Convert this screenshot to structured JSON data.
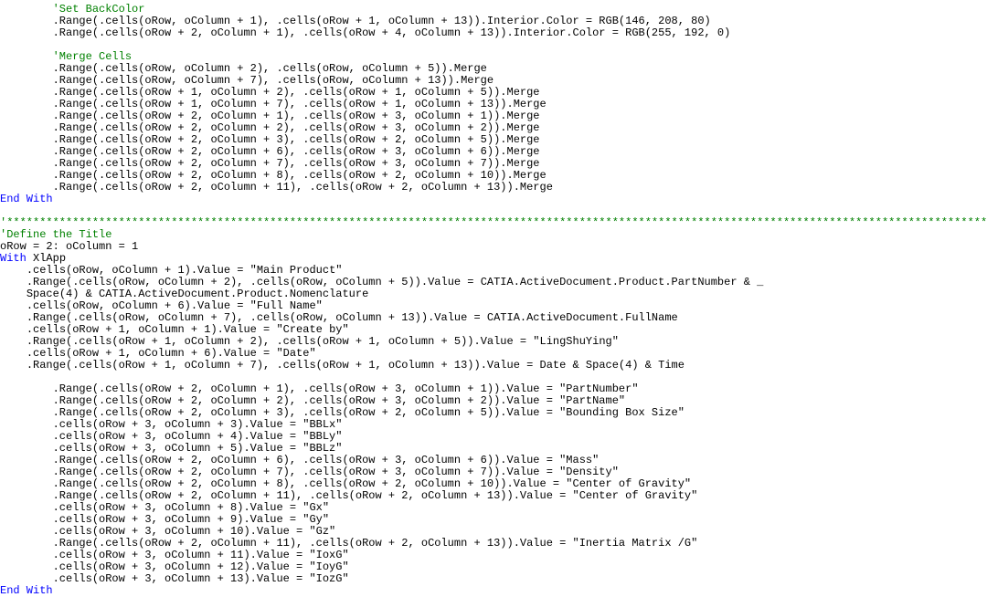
{
  "code_lines": [
    {
      "indent": 8,
      "spans": [
        {
          "cls": "c-comment",
          "text": "'Set BackColor"
        }
      ]
    },
    {
      "indent": 8,
      "spans": [
        {
          "cls": "",
          "text": ".Range(.cells(oRow, oColumn + 1), .cells(oRow + 1, oColumn + 13)).Interior.Color = RGB(146, 208, 80)"
        }
      ]
    },
    {
      "indent": 8,
      "spans": [
        {
          "cls": "",
          "text": ".Range(.cells(oRow + 2, oColumn + 1), .cells(oRow + 4, oColumn + 13)).Interior.Color = RGB(255, 192, 0)"
        }
      ]
    },
    {
      "indent": 0,
      "spans": [
        {
          "cls": "",
          "text": ""
        }
      ]
    },
    {
      "indent": 8,
      "spans": [
        {
          "cls": "c-comment",
          "text": "'Merge Cells"
        }
      ]
    },
    {
      "indent": 8,
      "spans": [
        {
          "cls": "",
          "text": ".Range(.cells(oRow, oColumn + 2), .cells(oRow, oColumn + 5)).Merge"
        }
      ]
    },
    {
      "indent": 8,
      "spans": [
        {
          "cls": "",
          "text": ".Range(.cells(oRow, oColumn + 7), .cells(oRow, oColumn + 13)).Merge"
        }
      ]
    },
    {
      "indent": 8,
      "spans": [
        {
          "cls": "",
          "text": ".Range(.cells(oRow + 1, oColumn + 2), .cells(oRow + 1, oColumn + 5)).Merge"
        }
      ]
    },
    {
      "indent": 8,
      "spans": [
        {
          "cls": "",
          "text": ".Range(.cells(oRow + 1, oColumn + 7), .cells(oRow + 1, oColumn + 13)).Merge"
        }
      ]
    },
    {
      "indent": 8,
      "spans": [
        {
          "cls": "",
          "text": ".Range(.cells(oRow + 2, oColumn + 1), .cells(oRow + 3, oColumn + 1)).Merge"
        }
      ]
    },
    {
      "indent": 8,
      "spans": [
        {
          "cls": "",
          "text": ".Range(.cells(oRow + 2, oColumn + 2), .cells(oRow + 3, oColumn + 2)).Merge"
        }
      ]
    },
    {
      "indent": 8,
      "spans": [
        {
          "cls": "",
          "text": ".Range(.cells(oRow + 2, oColumn + 3), .cells(oRow + 2, oColumn + 5)).Merge"
        }
      ]
    },
    {
      "indent": 8,
      "spans": [
        {
          "cls": "",
          "text": ".Range(.cells(oRow + 2, oColumn + 6), .cells(oRow + 3, oColumn + 6)).Merge"
        }
      ]
    },
    {
      "indent": 8,
      "spans": [
        {
          "cls": "",
          "text": ".Range(.cells(oRow + 2, oColumn + 7), .cells(oRow + 3, oColumn + 7)).Merge"
        }
      ]
    },
    {
      "indent": 8,
      "spans": [
        {
          "cls": "",
          "text": ".Range(.cells(oRow + 2, oColumn + 8), .cells(oRow + 2, oColumn + 10)).Merge"
        }
      ]
    },
    {
      "indent": 8,
      "spans": [
        {
          "cls": "",
          "text": ".Range(.cells(oRow + 2, oColumn + 11), .cells(oRow + 2, oColumn + 13)).Merge"
        }
      ]
    },
    {
      "indent": 0,
      "spans": [
        {
          "cls": "c-keyword",
          "text": "End With"
        }
      ]
    },
    {
      "indent": 0,
      "spans": [
        {
          "cls": "",
          "text": ""
        }
      ]
    },
    {
      "indent": 0,
      "spans": [
        {
          "cls": "c-comment",
          "text": "'*******************************************************************************************************************************************************************************"
        }
      ]
    },
    {
      "indent": 0,
      "spans": [
        {
          "cls": "c-comment",
          "text": "'Define the Title"
        }
      ]
    },
    {
      "indent": 0,
      "spans": [
        {
          "cls": "",
          "text": "oRow = 2: oColumn = 1"
        }
      ]
    },
    {
      "indent": 0,
      "spans": [
        {
          "cls": "c-keyword",
          "text": "With"
        },
        {
          "cls": "",
          "text": " XlApp"
        }
      ]
    },
    {
      "indent": 4,
      "spans": [
        {
          "cls": "",
          "text": ".cells(oRow, oColumn + 1).Value = \"Main Product\""
        }
      ]
    },
    {
      "indent": 4,
      "spans": [
        {
          "cls": "",
          "text": ".Range(.cells(oRow, oColumn + 2), .cells(oRow, oColumn + 5)).Value = CATIA.ActiveDocument.Product.PartNumber & _"
        }
      ]
    },
    {
      "indent": 4,
      "spans": [
        {
          "cls": "",
          "text": "Space(4) & CATIA.ActiveDocument.Product.Nomenclature"
        }
      ]
    },
    {
      "indent": 4,
      "spans": [
        {
          "cls": "",
          "text": ".cells(oRow, oColumn + 6).Value = \"Full Name\""
        }
      ]
    },
    {
      "indent": 4,
      "spans": [
        {
          "cls": "",
          "text": ".Range(.cells(oRow, oColumn + 7), .cells(oRow, oColumn + 13)).Value = CATIA.ActiveDocument.FullName"
        }
      ]
    },
    {
      "indent": 4,
      "spans": [
        {
          "cls": "",
          "text": ".cells(oRow + 1, oColumn + 1).Value = \"Create by\""
        }
      ]
    },
    {
      "indent": 4,
      "spans": [
        {
          "cls": "",
          "text": ".Range(.cells(oRow + 1, oColumn + 2), .cells(oRow + 1, oColumn + 5)).Value = \"LingShuYing\""
        }
      ]
    },
    {
      "indent": 4,
      "spans": [
        {
          "cls": "",
          "text": ".cells(oRow + 1, oColumn + 6).Value = \"Date\""
        }
      ]
    },
    {
      "indent": 4,
      "spans": [
        {
          "cls": "",
          "text": ".Range(.cells(oRow + 1, oColumn + 7), .cells(oRow + 1, oColumn + 13)).Value = Date & Space(4) & Time"
        }
      ]
    },
    {
      "indent": 0,
      "spans": [
        {
          "cls": "",
          "text": ""
        }
      ]
    },
    {
      "indent": 8,
      "spans": [
        {
          "cls": "",
          "text": ".Range(.cells(oRow + 2, oColumn + 1), .cells(oRow + 3, oColumn + 1)).Value = \"PartNumber\""
        }
      ]
    },
    {
      "indent": 8,
      "spans": [
        {
          "cls": "",
          "text": ".Range(.cells(oRow + 2, oColumn + 2), .cells(oRow + 3, oColumn + 2)).Value = \"PartName\""
        }
      ]
    },
    {
      "indent": 8,
      "spans": [
        {
          "cls": "",
          "text": ".Range(.cells(oRow + 2, oColumn + 3), .cells(oRow + 2, oColumn + 5)).Value = \"Bounding Box Size\""
        }
      ]
    },
    {
      "indent": 8,
      "spans": [
        {
          "cls": "",
          "text": ".cells(oRow + 3, oColumn + 3).Value = \"BBLx\""
        }
      ]
    },
    {
      "indent": 8,
      "spans": [
        {
          "cls": "",
          "text": ".cells(oRow + 3, oColumn + 4).Value = \"BBLy\""
        }
      ]
    },
    {
      "indent": 8,
      "spans": [
        {
          "cls": "",
          "text": ".cells(oRow + 3, oColumn + 5).Value = \"BBLz\""
        }
      ]
    },
    {
      "indent": 8,
      "spans": [
        {
          "cls": "",
          "text": ".Range(.cells(oRow + 2, oColumn + 6), .cells(oRow + 3, oColumn + 6)).Value = \"Mass\""
        }
      ]
    },
    {
      "indent": 8,
      "spans": [
        {
          "cls": "",
          "text": ".Range(.cells(oRow + 2, oColumn + 7), .cells(oRow + 3, oColumn + 7)).Value = \"Density\""
        }
      ]
    },
    {
      "indent": 8,
      "spans": [
        {
          "cls": "",
          "text": ".Range(.cells(oRow + 2, oColumn + 8), .cells(oRow + 2, oColumn + 10)).Value = \"Center of Gravity\""
        }
      ]
    },
    {
      "indent": 8,
      "spans": [
        {
          "cls": "",
          "text": ".Range(.cells(oRow + 2, oColumn + 11), .cells(oRow + 2, oColumn + 13)).Value = \"Center of Gravity\""
        }
      ]
    },
    {
      "indent": 8,
      "spans": [
        {
          "cls": "",
          "text": ".cells(oRow + 3, oColumn + 8).Value = \"Gx\""
        }
      ]
    },
    {
      "indent": 8,
      "spans": [
        {
          "cls": "",
          "text": ".cells(oRow + 3, oColumn + 9).Value = \"Gy\""
        }
      ]
    },
    {
      "indent": 8,
      "spans": [
        {
          "cls": "",
          "text": ".cells(oRow + 3, oColumn + 10).Value = \"Gz\""
        }
      ]
    },
    {
      "indent": 8,
      "spans": [
        {
          "cls": "",
          "text": ".Range(.cells(oRow + 2, oColumn + 11), .cells(oRow + 2, oColumn + 13)).Value = \"Inertia Matrix /G\""
        }
      ]
    },
    {
      "indent": 8,
      "spans": [
        {
          "cls": "",
          "text": ".cells(oRow + 3, oColumn + 11).Value = \"IoxG\""
        }
      ]
    },
    {
      "indent": 8,
      "spans": [
        {
          "cls": "",
          "text": ".cells(oRow + 3, oColumn + 12).Value = \"IoyG\""
        }
      ]
    },
    {
      "indent": 8,
      "spans": [
        {
          "cls": "",
          "text": ".cells(oRow + 3, oColumn + 13).Value = \"IozG\""
        }
      ]
    },
    {
      "indent": 0,
      "spans": [
        {
          "cls": "c-keyword",
          "text": "End With"
        }
      ]
    }
  ]
}
